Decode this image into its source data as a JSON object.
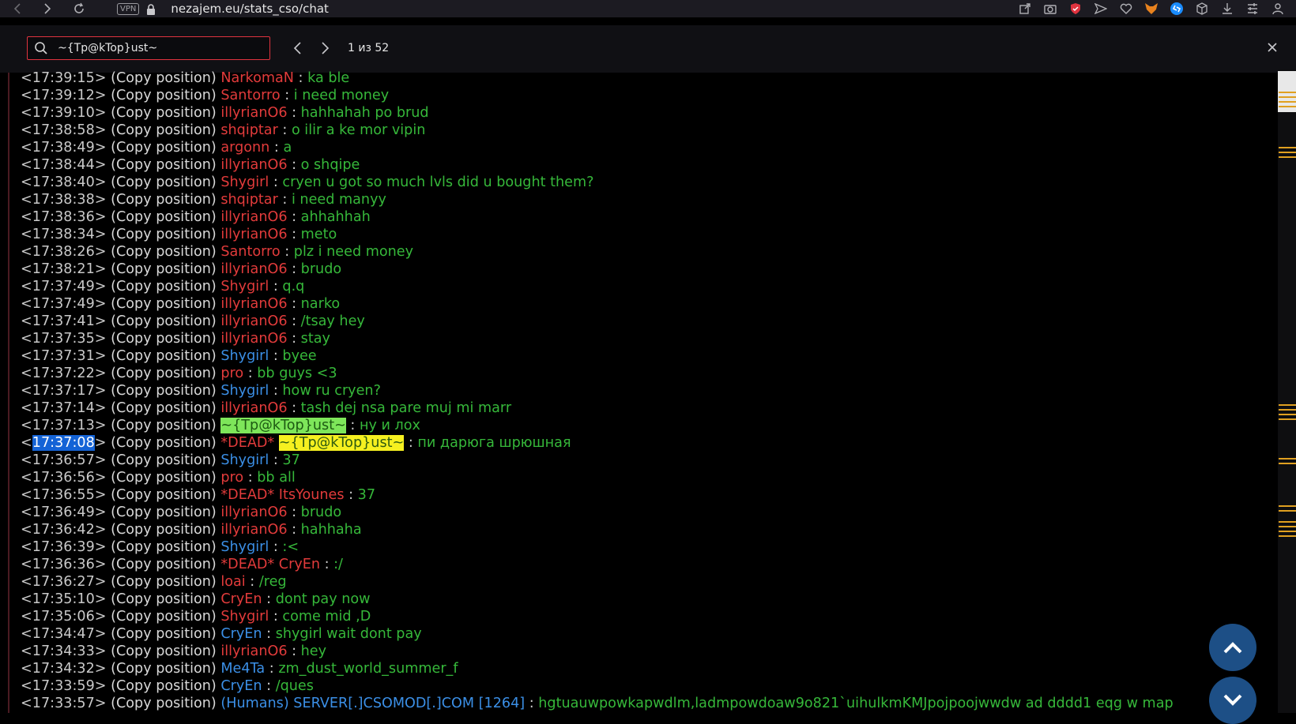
{
  "browser": {
    "vpn_label": "VPN",
    "url": "nezajem.eu/stats_cso/chat"
  },
  "find": {
    "query": "~{Tp@kTop}ust~",
    "count_label": "1 из 52"
  },
  "colors": {
    "name_red": "#e23b3b",
    "name_blue": "#3b8fe6",
    "message_green": "#36b83a",
    "highlight_current": "#7ee65a",
    "highlight_match": "#f6f020",
    "timestamp_selected": "#1463d6"
  },
  "chat": [
    {
      "time": "17:39:15",
      "tag": "(Copy position)",
      "name": "NarkomaN",
      "name_color": "red",
      "msg": "ka ble"
    },
    {
      "time": "17:39:12",
      "tag": "(Copy position)",
      "name": "Santorro",
      "name_color": "red",
      "msg": "i need money"
    },
    {
      "time": "17:39:10",
      "tag": "(Copy position)",
      "name": "illyrianO6",
      "name_color": "red",
      "msg": "hahhahah po brud"
    },
    {
      "time": "17:38:58",
      "tag": "(Copy position)",
      "name": "shqiptar",
      "name_color": "red",
      "msg": "o ilir a ke mor vipin"
    },
    {
      "time": "17:38:49",
      "tag": "(Copy position)",
      "name": "argonn",
      "name_color": "red",
      "msg": "a"
    },
    {
      "time": "17:38:44",
      "tag": "(Copy position)",
      "name": "illyrianO6",
      "name_color": "red",
      "msg": "o shqipe"
    },
    {
      "time": "17:38:40",
      "tag": "(Copy position)",
      "name": "Shygirl",
      "name_color": "red",
      "msg": "cryen u got so much lvls did u bought them?"
    },
    {
      "time": "17:38:38",
      "tag": "(Copy position)",
      "name": "shqiptar",
      "name_color": "red",
      "msg": "i need manyy"
    },
    {
      "time": "17:38:36",
      "tag": "(Copy position)",
      "name": "illyrianO6",
      "name_color": "red",
      "msg": "ahhahhah"
    },
    {
      "time": "17:38:34",
      "tag": "(Copy position)",
      "name": "illyrianO6",
      "name_color": "red",
      "msg": "meto"
    },
    {
      "time": "17:38:26",
      "tag": "(Copy position)",
      "name": "Santorro",
      "name_color": "red",
      "msg": "plz i need money"
    },
    {
      "time": "17:38:21",
      "tag": "(Copy position)",
      "name": "illyrianO6",
      "name_color": "red",
      "msg": "brudo"
    },
    {
      "time": "17:37:49",
      "tag": "(Copy position)",
      "name": "Shygirl",
      "name_color": "red",
      "msg": "q.q"
    },
    {
      "time": "17:37:49",
      "tag": "(Copy position)",
      "name": "illyrianO6",
      "name_color": "red",
      "msg": "narko"
    },
    {
      "time": "17:37:41",
      "tag": "(Copy position)",
      "name": "illyrianO6",
      "name_color": "red",
      "msg": "/tsay hey"
    },
    {
      "time": "17:37:35",
      "tag": "(Copy position)",
      "name": "illyrianO6",
      "name_color": "red",
      "msg": "stay"
    },
    {
      "time": "17:37:31",
      "tag": "(Copy position)",
      "name": "Shygirl",
      "name_color": "blue",
      "msg": "byee"
    },
    {
      "time": "17:37:22",
      "tag": "(Copy position)",
      "name": "pro",
      "name_color": "red",
      "msg": "bb guys <3"
    },
    {
      "time": "17:37:17",
      "tag": "(Copy position)",
      "name": "Shygirl",
      "name_color": "blue",
      "msg": "how ru cryen?"
    },
    {
      "time": "17:37:14",
      "tag": "(Copy position)",
      "name": "illyrianO6",
      "name_color": "red",
      "msg": "tash dej nsa pare muj mi marr"
    },
    {
      "time": "17:37:13",
      "tag": "(Copy position)",
      "name": "~{Tp@kTop}ust~",
      "name_color": "hl-green",
      "msg": "ну и лох"
    },
    {
      "time": "17:37:08",
      "tag": "(Copy position)",
      "prefix": "*DEAD*",
      "name": "~{Tp@kTop}ust~",
      "name_color": "hl-yellow",
      "msg": "пи дарюга шрюшная",
      "ts_selected": true
    },
    {
      "time": "17:36:57",
      "tag": "(Copy position)",
      "name": "Shygirl",
      "name_color": "blue",
      "msg": "37"
    },
    {
      "time": "17:36:56",
      "tag": "(Copy position)",
      "name": "pro",
      "name_color": "red",
      "msg": "bb all"
    },
    {
      "time": "17:36:55",
      "tag": "(Copy position)",
      "prefix": "*DEAD*",
      "name": "ItsYounes",
      "name_color": "red",
      "msg": "37"
    },
    {
      "time": "17:36:49",
      "tag": "(Copy position)",
      "name": "illyrianO6",
      "name_color": "red",
      "msg": "brudo"
    },
    {
      "time": "17:36:42",
      "tag": "(Copy position)",
      "name": "illyrianO6",
      "name_color": "red",
      "msg": "hahhaha"
    },
    {
      "time": "17:36:39",
      "tag": "(Copy position)",
      "name": "Shygirl",
      "name_color": "blue",
      "msg": ":<"
    },
    {
      "time": "17:36:36",
      "tag": "(Copy position)",
      "prefix": "*DEAD*",
      "name": "CryEn",
      "name_color": "red",
      "msg": ":/"
    },
    {
      "time": "17:36:27",
      "tag": "(Copy position)",
      "name": "loai",
      "name_color": "red",
      "msg": "/reg"
    },
    {
      "time": "17:35:10",
      "tag": "(Copy position)",
      "name": "CryEn",
      "name_color": "red",
      "msg": "dont pay now"
    },
    {
      "time": "17:35:06",
      "tag": "(Copy position)",
      "name": "Shygirl",
      "name_color": "red",
      "msg": "come mid ,D"
    },
    {
      "time": "17:34:47",
      "tag": "(Copy position)",
      "name": "CryEn",
      "name_color": "blue",
      "msg": "shygirl wait dont pay"
    },
    {
      "time": "17:34:33",
      "tag": "(Copy position)",
      "name": "illyrianO6",
      "name_color": "red",
      "msg": "hey"
    },
    {
      "time": "17:34:32",
      "tag": "(Copy position)",
      "name": "Me4Ta",
      "name_color": "blue",
      "msg": "zm_dust_world_summer_f"
    },
    {
      "time": "17:33:59",
      "tag": "(Copy position)",
      "name": "CryEn",
      "name_color": "blue",
      "msg": "/ques"
    },
    {
      "time": "17:33:57",
      "tag": "(Copy position)",
      "name": "(Humans) SERVER[.]CSOMOD[.]COM [1264]",
      "name_color": "blue",
      "msg": "hgtuauwpowkapwdlm,ladmpowdoaw9o821`uihulkmKMJpojpoojwwdw ad dddd1 eqg w map"
    }
  ]
}
